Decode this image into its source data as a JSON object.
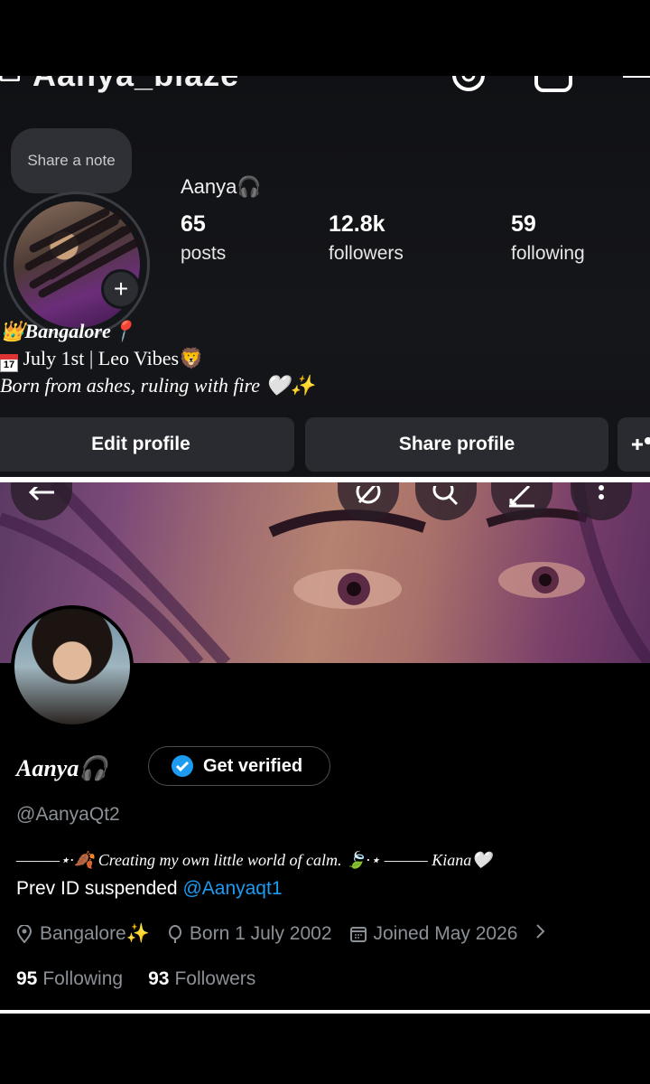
{
  "instagram": {
    "username": "Aanya_blaze",
    "note_placeholder": "Share a note",
    "display_name": "Aanya🎧",
    "stats": [
      {
        "value": "65",
        "label": "posts"
      },
      {
        "value": "12.8k",
        "label": "followers"
      },
      {
        "value": "59",
        "label": "following"
      }
    ],
    "bio": {
      "line1": "👑Bangalore📍",
      "line2_icon_text": "17",
      "line2": "July 1st | Leo Vibes🦁",
      "line3": "Born from ashes, ruling with fire 🤍✨"
    },
    "buttons": {
      "edit": "Edit profile",
      "share": "Share profile"
    }
  },
  "x_profile": {
    "display_name": "Aanya🎧",
    "verify_label": "Get verified",
    "handle": "@AanyaQt2",
    "bio_line1": "———⋆·🍂 Creating my own little world of calm. 🍃·⋆ ——— Kiana🤍",
    "bio_line2_prefix": "Prev ID suspended ",
    "bio_line2_link": "@Aanyaqt1",
    "location": "Bangalore✨",
    "birth": "Born 1 July 2002",
    "joined": "Joined May 2026",
    "following_count": "95",
    "following_label": "Following",
    "followers_count": "93",
    "followers_label": "Followers"
  },
  "colors": {
    "link_blue": "#1d9bf0",
    "muted_gray": "#8b9096",
    "ig_button_bg": "#2a2b30"
  },
  "icons": [
    "menu-icon",
    "threads-icon",
    "add-post-icon",
    "plus-icon",
    "back-arrow-icon",
    "grok-icon",
    "search-icon",
    "compose-icon",
    "more-icon",
    "verified-badge-icon",
    "location-icon",
    "birthday-icon",
    "calendar-icon",
    "chevron-right-icon",
    "add-person-icon"
  ]
}
